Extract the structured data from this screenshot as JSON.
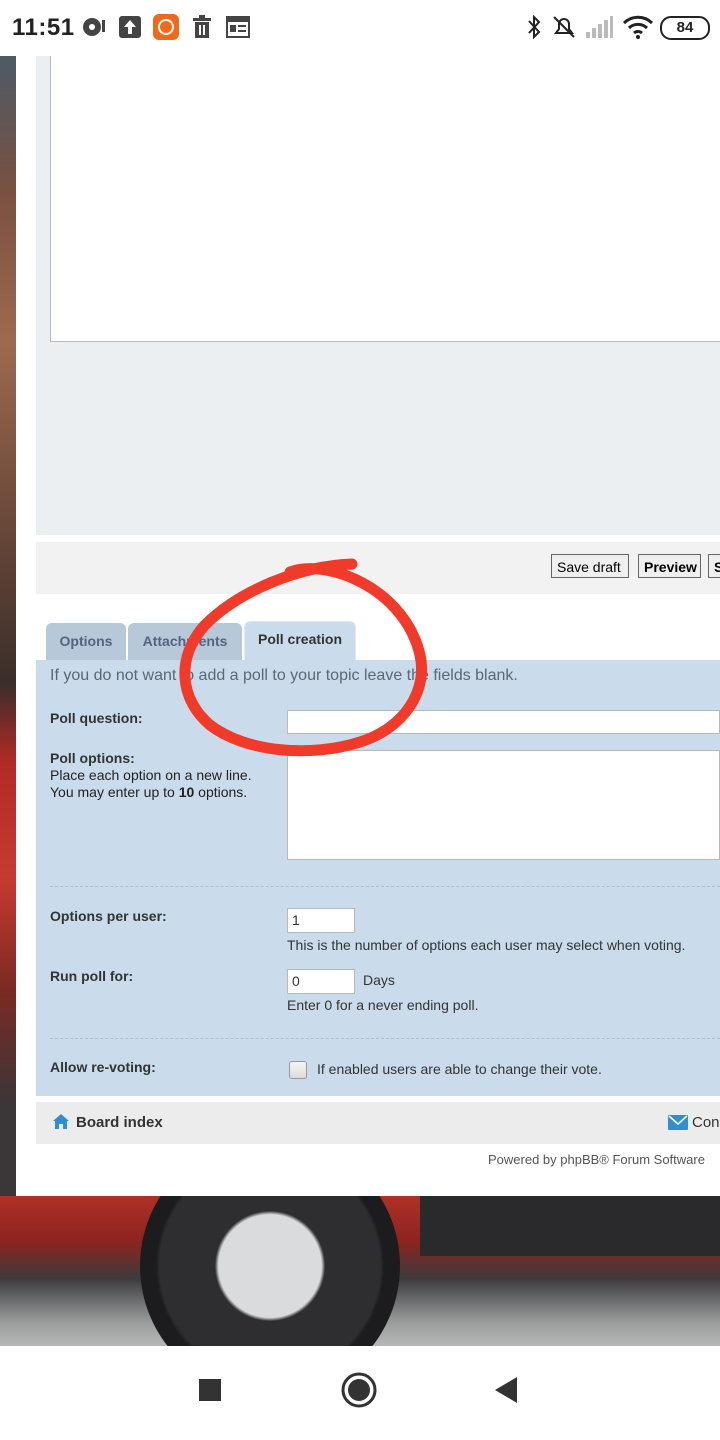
{
  "status_bar": {
    "time": "11:51",
    "battery": "84"
  },
  "form": {
    "buttons": {
      "save_draft": "Save draft",
      "preview": "Preview",
      "submit_partial": "S"
    },
    "tabs": [
      {
        "label": "Options",
        "active": false
      },
      {
        "label": "Attachments",
        "active": false
      },
      {
        "label": "Poll creation",
        "active": true
      }
    ],
    "poll": {
      "intro": "If you do not want to add a poll to your topic leave the fields blank.",
      "question_label": "Poll question:",
      "question_value": "",
      "options_label": "Poll options:",
      "options_hint_1": "Place each option on a new line.",
      "options_hint_2_prefix": "You may enter up to ",
      "options_hint_2_number": "10",
      "options_hint_2_suffix": " options.",
      "options_value": "",
      "per_user_label": "Options per user:",
      "per_user_value": "1",
      "per_user_note": "This is the number of options each user may select when voting.",
      "run_for_label": "Run poll for:",
      "run_for_value": "0",
      "run_for_unit": "Days",
      "run_for_note": "Enter 0 for a never ending poll.",
      "revote_label": "Allow re-voting:",
      "revote_checked": false,
      "revote_note": "If enabled users are able to change their vote."
    }
  },
  "footer": {
    "board_index": "Board index",
    "contact_partial": "Con",
    "powered_by": "Powered by phpBB® Forum Software"
  },
  "colors": {
    "panel_bg": "#cadceb",
    "tab_inactive": "#b7c8d8",
    "annotation_red": "#f03a2a",
    "link_icon_blue": "#2f8fd0"
  },
  "nav": {
    "icons": [
      "recents-square-icon",
      "home-circle-icon",
      "back-triangle-icon"
    ]
  }
}
